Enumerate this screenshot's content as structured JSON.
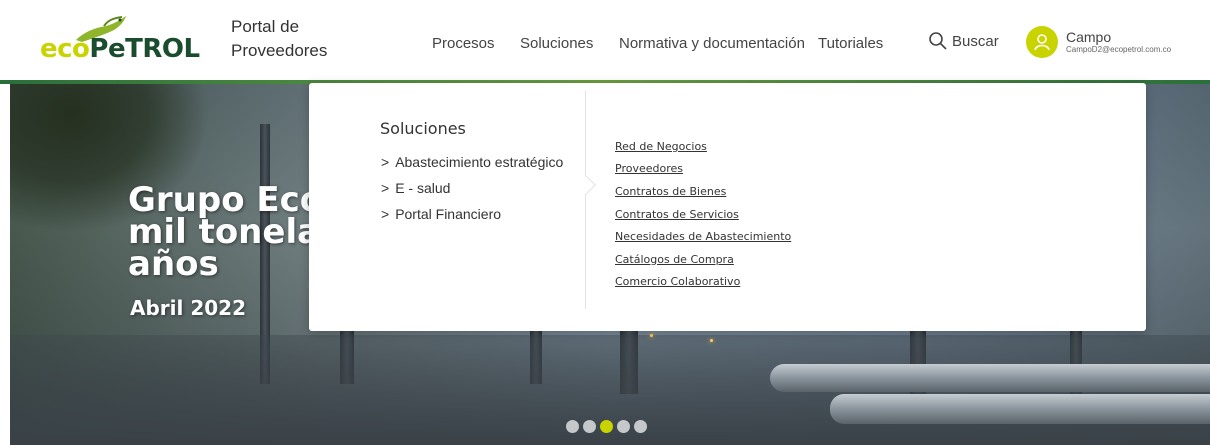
{
  "header": {
    "logo": {
      "eco": "eco",
      "petrol": "PeTROL",
      "brand_color": "#c9d300",
      "brand_dark": "#1a4d2e"
    },
    "portal_title": "Portal de Proveedores",
    "nav": [
      "Procesos",
      "Soluciones",
      "Normativa y documentación",
      "Tutoriales"
    ],
    "search_label": "Buscar",
    "user": {
      "name": "Campo",
      "email": "CampoD2@ecopetrol.com.co"
    }
  },
  "hero": {
    "title": "Grupo Ecop\nmil tonelad\naños",
    "date": "Abril 2022",
    "carousel": {
      "count": 5,
      "active_index": 2
    }
  },
  "dropdown": {
    "title": "Soluciones",
    "categories": [
      {
        "label": "Abastecimiento estratégico",
        "icon": "chevron-right-icon"
      },
      {
        "label": "E - salud",
        "icon": "chevron-right-icon"
      },
      {
        "label": "Portal Financiero",
        "icon": "chevron-right-icon"
      }
    ],
    "links": [
      "Red de Negocios",
      "Proveedores",
      "Contratos de Bienes",
      "Contratos de Servicios",
      "Necesidades de Abastecimiento",
      "Catálogos de Compra",
      "Comercio Colaborativo"
    ]
  }
}
